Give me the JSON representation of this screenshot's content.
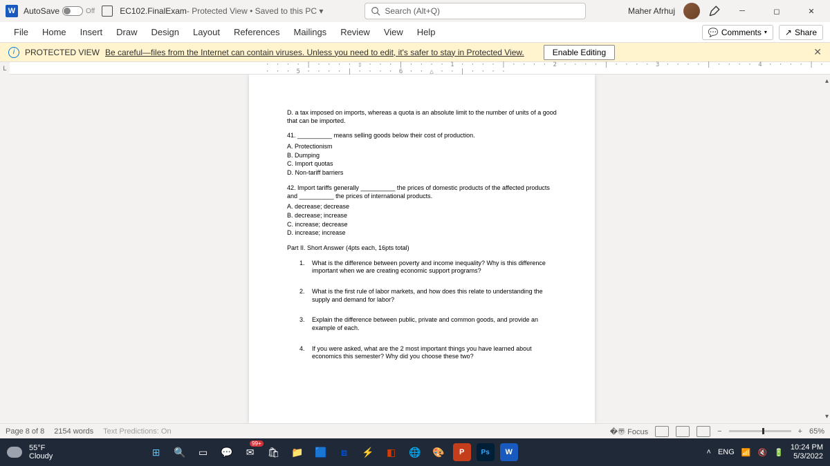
{
  "title": {
    "autosave_label": "AutoSave",
    "autosave_state": "Off",
    "doc_name": "EC102.FinalExam",
    "doc_status": " - Protected View • Saved to this PC ▾",
    "search_placeholder": "Search (Alt+Q)",
    "user": "Maher Afrhuj"
  },
  "tabs": [
    "File",
    "Home",
    "Insert",
    "Draw",
    "Design",
    "Layout",
    "References",
    "Mailings",
    "Review",
    "View",
    "Help"
  ],
  "ribbon_right": {
    "comments": "Comments",
    "share": "Share"
  },
  "protected": {
    "label": "PROTECTED VIEW",
    "msg": "Be careful—files from the Internet can contain viruses. Unless you need to edit, it's safer to stay in Protected View.",
    "enable": "Enable Editing"
  },
  "ruler": "· · · · | · · · · ▯ · · · | · · · · 1 · · · · | · · · · 2 · · · · | · · · · 3 · · · · | · · · · 4 · · · · | · · · · 5 · · · · | · · · · 6 · · △ · · | · · · ·",
  "doc": {
    "q40d": "D. a tax imposed on imports, whereas a quota is an absolute limit to the number of units of a good that can be imported.",
    "q41": "41. __________ means selling goods below their cost of production.",
    "q41opts": [
      "A. Protectionism",
      "B. Dumping",
      "C. Import quotas",
      "D. Non-tariff barriers"
    ],
    "q42": "42. Import tariffs generally __________ the prices of domestic products of the affected products and __________ the prices of international products.",
    "q42opts": [
      "A. decrease; decrease",
      "B. decrease; increase",
      "C. increase; decrease",
      "D. increase; increase"
    ],
    "part2": "Part II. Short Answer (4pts each, 16pts total)",
    "sa": [
      "What is the difference between poverty and income inequality? Why is this difference important when we are creating economic support programs?",
      "What is the first rule of labor markets, and how does this relate to understanding the supply and demand for labor?",
      "Explain the difference between public, private and common goods, and provide an example of each.",
      "If you were asked, what are the 2 most important things you have learned about economics this semester? Why did you choose these two?"
    ]
  },
  "status": {
    "page": "Page 8 of 8",
    "words": "2154 words",
    "predictions": "Text Predictions: On",
    "focus": "Focus",
    "zoom": "65%"
  },
  "taskbar": {
    "temp": "55°F",
    "cond": "Cloudy",
    "lang": "ENG",
    "time": "10:24 PM",
    "date": "5/3/2022",
    "badge": "99+"
  }
}
